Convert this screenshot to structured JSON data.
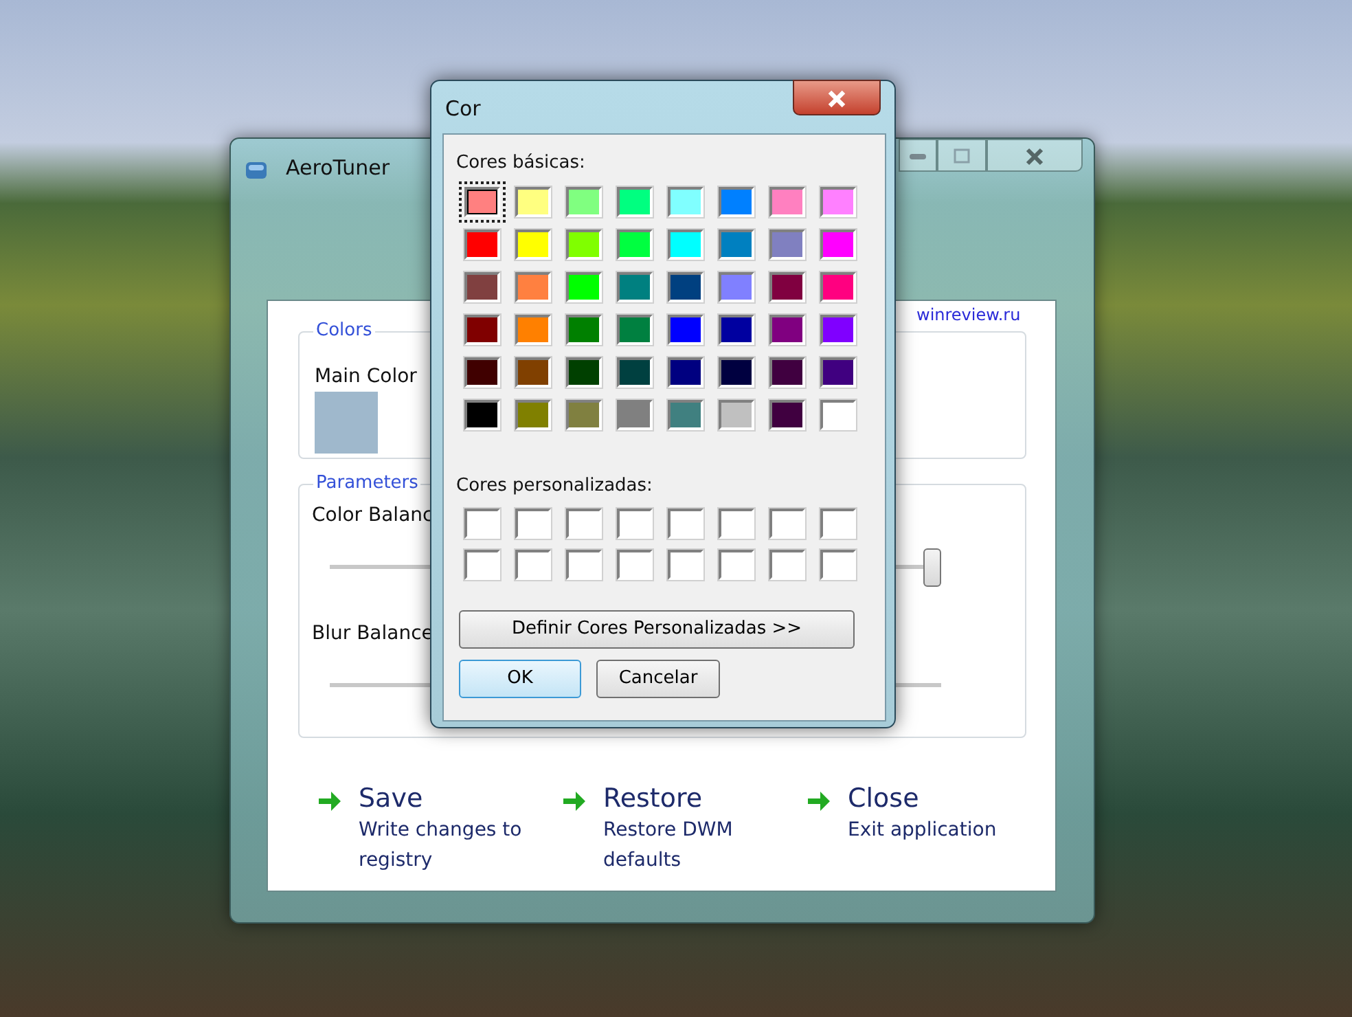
{
  "main_window": {
    "title": "AeroTuner",
    "link": "winreview.ru",
    "colors_group": {
      "legend": "Colors",
      "label": "Main Color",
      "color": "#9fb8cc"
    },
    "parameters_group": {
      "legend": "Parameters",
      "sliders": [
        {
          "label": "Color Balanc",
          "level": 1
        },
        {
          "label": "Blur Balance"
        }
      ]
    },
    "actions": [
      {
        "title": "Save",
        "description": "Write changes to registry"
      },
      {
        "title": "Restore",
        "description": "Restore DWM defaults"
      },
      {
        "title": "Close",
        "description": "Exit application"
      }
    ]
  },
  "color_dialog": {
    "title": "Cor",
    "basic_label": "Cores básicas:",
    "basic_colors": [
      {
        "color": "#ff8080",
        "selected": true
      },
      {
        "color": "#ffff80",
        "selected": false
      },
      {
        "color": "#80ff80",
        "selected": false
      },
      {
        "color": "#00ff80",
        "selected": false
      },
      {
        "color": "#80ffff",
        "selected": false
      },
      {
        "color": "#0080ff",
        "selected": false
      },
      {
        "color": "#ff80c0",
        "selected": false
      },
      {
        "color": "#ff80ff",
        "selected": false
      },
      {
        "color": "#ff0000",
        "selected": false
      },
      {
        "color": "#ffff00",
        "selected": false
      },
      {
        "color": "#80ff00",
        "selected": false
      },
      {
        "color": "#00ff40",
        "selected": false
      },
      {
        "color": "#00ffff",
        "selected": false
      },
      {
        "color": "#0080c0",
        "selected": false
      },
      {
        "color": "#8080c0",
        "selected": false
      },
      {
        "color": "#ff00ff",
        "selected": false
      },
      {
        "color": "#804040",
        "selected": false
      },
      {
        "color": "#ff8040",
        "selected": false
      },
      {
        "color": "#00ff00",
        "selected": false
      },
      {
        "color": "#008080",
        "selected": false
      },
      {
        "color": "#004080",
        "selected": false
      },
      {
        "color": "#8080ff",
        "selected": false
      },
      {
        "color": "#800040",
        "selected": false
      },
      {
        "color": "#ff0080",
        "selected": false
      },
      {
        "color": "#800000",
        "selected": false
      },
      {
        "color": "#ff8000",
        "selected": false
      },
      {
        "color": "#008000",
        "selected": false
      },
      {
        "color": "#008040",
        "selected": false
      },
      {
        "color": "#0000ff",
        "selected": false
      },
      {
        "color": "#0000a0",
        "selected": false
      },
      {
        "color": "#800080",
        "selected": false
      },
      {
        "color": "#8000ff",
        "selected": false
      },
      {
        "color": "#400000",
        "selected": false
      },
      {
        "color": "#804000",
        "selected": false
      },
      {
        "color": "#004000",
        "selected": false
      },
      {
        "color": "#004040",
        "selected": false
      },
      {
        "color": "#000080",
        "selected": false
      },
      {
        "color": "#000040",
        "selected": false
      },
      {
        "color": "#400040",
        "selected": false
      },
      {
        "color": "#400080",
        "selected": false
      },
      {
        "color": "#000000",
        "selected": false
      },
      {
        "color": "#808000",
        "selected": false
      },
      {
        "color": "#808040",
        "selected": false
      },
      {
        "color": "#808080",
        "selected": false
      },
      {
        "color": "#408080",
        "selected": false
      },
      {
        "color": "#c0c0c0",
        "selected": false
      },
      {
        "color": "#400040",
        "selected": false
      },
      {
        "color": "#ffffff",
        "selected": false
      }
    ],
    "custom_label": "Cores personalizadas:",
    "custom_colors": [
      {
        "color": "#ffffff"
      },
      {
        "color": "#ffffff"
      },
      {
        "color": "#ffffff"
      },
      {
        "color": "#ffffff"
      },
      {
        "color": "#ffffff"
      },
      {
        "color": "#ffffff"
      },
      {
        "color": "#ffffff"
      },
      {
        "color": "#ffffff"
      },
      {
        "color": "#ffffff"
      },
      {
        "color": "#ffffff"
      },
      {
        "color": "#ffffff"
      },
      {
        "color": "#ffffff"
      },
      {
        "color": "#ffffff"
      },
      {
        "color": "#ffffff"
      },
      {
        "color": "#ffffff"
      },
      {
        "color": "#ffffff"
      }
    ],
    "define_button": "Definir Cores Personalizadas >>",
    "ok_button": "OK",
    "cancel_button": "Cancelar"
  }
}
